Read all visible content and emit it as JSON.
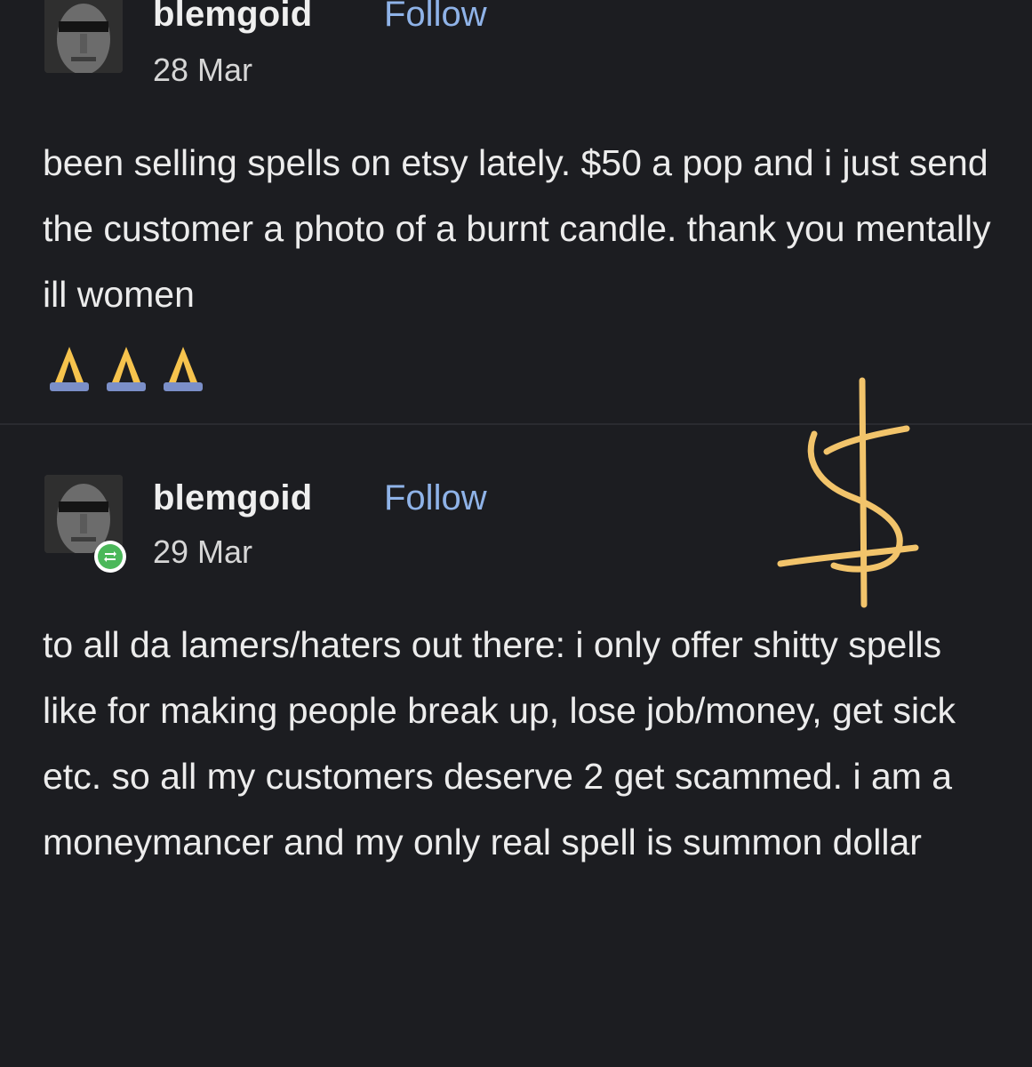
{
  "posts": [
    {
      "username": "blemgoid",
      "follow_label": "Follow",
      "date": "28 Mar",
      "text": "been selling spells on etsy lately. $50 a pop and i just send the customer a photo of a burnt candle. thank you mentally ill women",
      "emojis": [
        "folded-hands-emoji",
        "folded-hands-emoji",
        "folded-hands-emoji"
      ]
    },
    {
      "username": "blemgoid",
      "follow_label": "Follow",
      "date": "29 Mar",
      "reblog_badge": "reblog-icon",
      "text": "to all da lamers/haters out there: i only offer shitty spells like for making people break up, lose job/money, get sick etc. so all my customers deserve 2 get scammed. i am a moneymancer and my only real spell is summon dollar"
    }
  ],
  "colors": {
    "background": "#1c1d21",
    "text": "#ececec",
    "follow_link": "#8fb3e8",
    "reblog_green": "#4bb85a",
    "doodle_gold": "#f2c46b"
  }
}
